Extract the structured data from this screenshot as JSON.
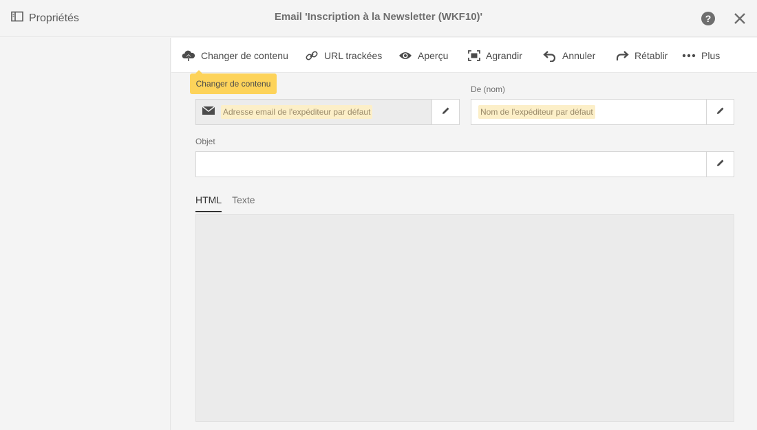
{
  "header": {
    "properties_label": "Propriétés",
    "title": "Email 'Inscription à la Newsletter (WKF10)'",
    "help_glyph": "?"
  },
  "toolbar": {
    "items": [
      {
        "label": "Changer de contenu",
        "icon": "cloud-upload-icon"
      },
      {
        "label": "URL trackées",
        "icon": "link-icon"
      },
      {
        "label": "Aperçu",
        "icon": "eye-icon"
      },
      {
        "label": "Agrandir",
        "icon": "expand-icon"
      },
      {
        "label": "Annuler",
        "icon": "undo-icon"
      },
      {
        "label": "Rétablir",
        "icon": "redo-icon"
      },
      {
        "label": "Plus",
        "icon": "more-icon"
      }
    ],
    "tooltip": "Changer de contenu"
  },
  "form": {
    "sender_email_placeholder": "Adresse email de l'expéditeur par défaut",
    "from_name_label": "De (nom)",
    "from_name_placeholder": "Nom de l'expéditeur par défaut",
    "subject_label": "Objet",
    "subject_value": ""
  },
  "tabs": [
    {
      "label": "HTML",
      "active": true
    },
    {
      "label": "Texte",
      "active": false
    }
  ],
  "colors": {
    "tooltip_bg": "#fdd35a",
    "placeholder_highlight": "#fcefc8"
  }
}
